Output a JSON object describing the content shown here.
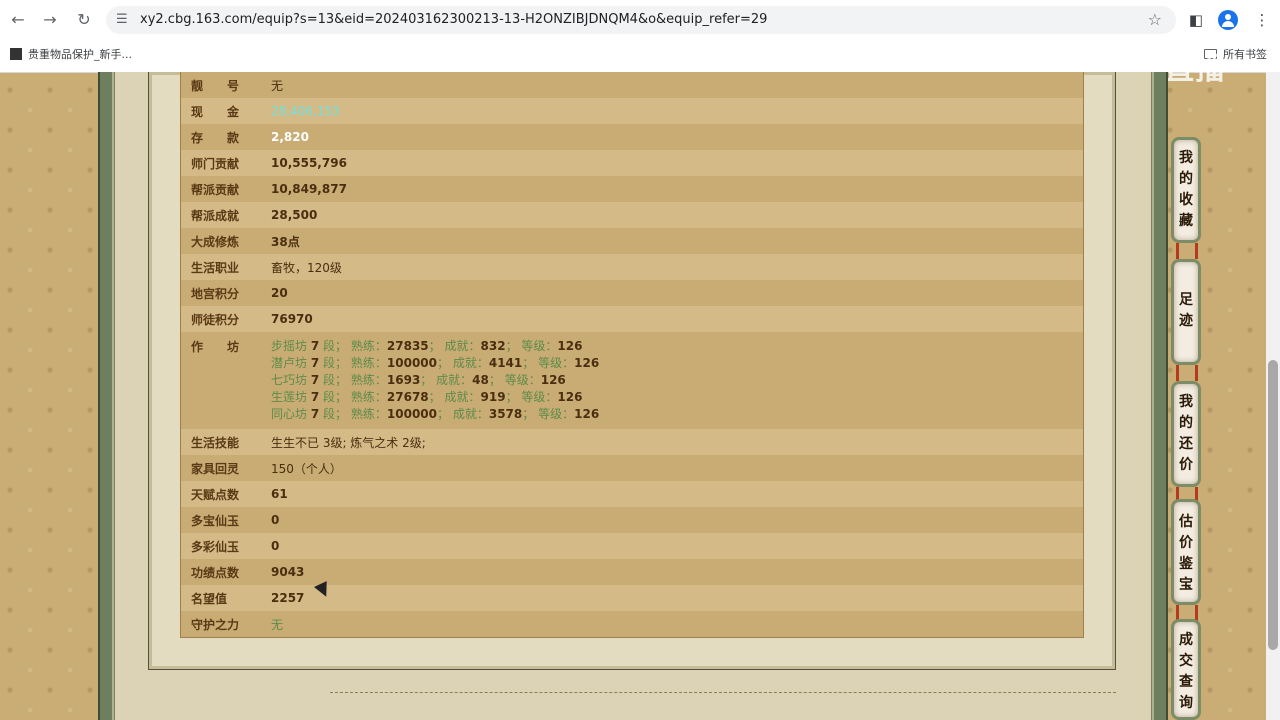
{
  "browser": {
    "url": "xy2.cbg.163.com/equip?s=13&eid=202403162300213-13-H2ONZIBJDNQM4&o&equip_refer=29",
    "bookmark_item": "贵重物品保护_新手...",
    "all_bookmarks": "所有书签",
    "icons": [
      "back-icon",
      "forward-icon",
      "reload-icon",
      "site-settings-icon",
      "star-icon",
      "side-panel-icon",
      "profile-icon",
      "menu-icon"
    ]
  },
  "watermark": "CC直播",
  "rows": [
    {
      "label": "靓　　号",
      "value": "无"
    },
    {
      "label": "现　　金",
      "value": "28,406,153"
    },
    {
      "label": "存　　款",
      "value": "2,820"
    },
    {
      "label": "师门贡献",
      "value": "10,555,796"
    },
    {
      "label": "帮派贡献",
      "value": "10,849,877"
    },
    {
      "label": "帮派成就",
      "value": "28,500"
    },
    {
      "label": "大成修炼",
      "value": "38点"
    },
    {
      "label": "生活职业",
      "value": "畜牧，120级"
    },
    {
      "label": "地宫积分",
      "value": "20"
    },
    {
      "label": "师徒积分",
      "value": "76970"
    }
  ],
  "workshop": {
    "label": "作　　坊",
    "lines": [
      {
        "name": "步摇坊",
        "duan": "7",
        "shulian": "27835",
        "chengjiu": "832",
        "dengji": "126"
      },
      {
        "name": "潜卢坊",
        "duan": "7",
        "shulian": "100000",
        "chengjiu": "4141",
        "dengji": "126"
      },
      {
        "name": "七巧坊",
        "duan": "7",
        "shulian": "1693",
        "chengjiu": "48",
        "dengji": "126"
      },
      {
        "name": "生莲坊",
        "duan": "7",
        "shulian": "27678",
        "chengjiu": "919",
        "dengji": "126"
      },
      {
        "name": "同心坊",
        "duan": "7",
        "shulian": "100000",
        "chengjiu": "3578",
        "dengji": "126"
      }
    ],
    "words": {
      "duan": "段；",
      "shulian": "熟练：",
      "chengjiu": "成就：",
      "dengji": "等级："
    }
  },
  "rows2": [
    {
      "label": "生活技能",
      "value": "生生不已 3级; 炼气之术 2级;"
    },
    {
      "label": "家具回灵",
      "value": "150（个人）"
    },
    {
      "label": "天赋点数",
      "value": "61"
    },
    {
      "label": "多宝仙玉",
      "value": "0"
    },
    {
      "label": "多彩仙玉",
      "value": "0"
    },
    {
      "label": "功绩点数",
      "value": "9043"
    },
    {
      "label": "名望值",
      "value": "2257"
    },
    {
      "label": "守护之力",
      "value": "无"
    }
  ],
  "side_tabs": [
    "我的收藏",
    "足迹",
    "我的还价",
    "估价鉴宝",
    "成交查询"
  ],
  "colors": {
    "cyan": "#6fe3df",
    "green": "#5f8a4a",
    "label": "#5a3a16",
    "row_dark": "#c8ac74",
    "row_light": "#d4ba86"
  }
}
